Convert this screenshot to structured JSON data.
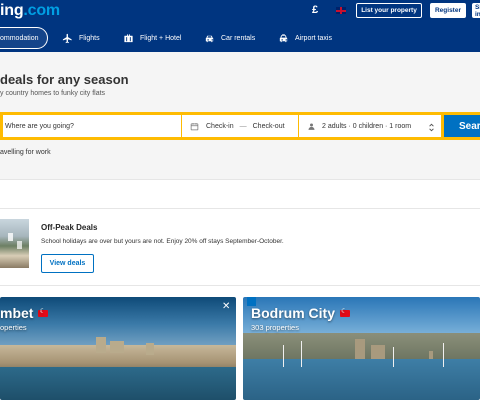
{
  "header": {
    "logo_main": "ing",
    "logo_tld": ".com",
    "currency": "£",
    "language": "English (UK)",
    "list_property": "List your property",
    "register": "Register",
    "sign_in": "Sign in"
  },
  "nav": {
    "items": [
      {
        "label": "ommodation",
        "icon": "bed-icon",
        "active": true
      },
      {
        "label": "Flights",
        "icon": "plane-icon",
        "active": false
      },
      {
        "label": "Flight + Hotel",
        "icon": "suitcase-icon",
        "active": false
      },
      {
        "label": "Car rentals",
        "icon": "car-icon",
        "active": false
      },
      {
        "label": "Airport taxis",
        "icon": "taxi-icon",
        "active": false
      }
    ]
  },
  "hero": {
    "title": "deals for any season",
    "subtitle": "y country homes to funky city flats"
  },
  "search": {
    "destination": "Where are you going?",
    "check_in": "Check-in",
    "date_separator": "—",
    "check_out": "Check-out",
    "guests": "2 adults · 0 children · 1 room",
    "button": "Sear",
    "work_travel": "avelling for work"
  },
  "offpeak": {
    "title": "Off-Peak Deals",
    "description": "School holidays are over but yours are not. Enjoy 20% off stays September-October.",
    "button": "View deals"
  },
  "destinations": [
    {
      "name": "mbet",
      "count": "operties"
    },
    {
      "name": "Bodrum City",
      "count": "303 properties"
    }
  ],
  "colors": {
    "brand_blue": "#003580",
    "accent_blue": "#0071c2",
    "search_border": "#febb02",
    "turkey_red": "#e30a17"
  }
}
